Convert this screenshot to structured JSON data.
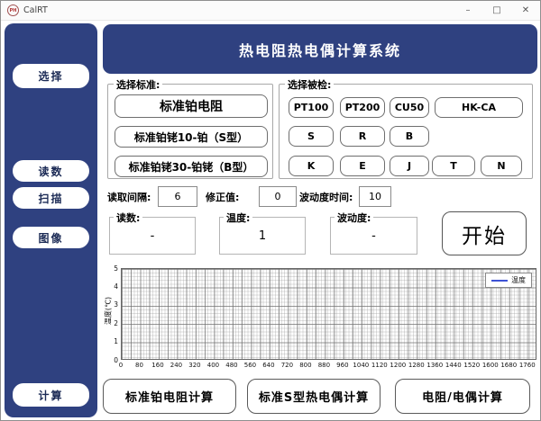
{
  "titlebar": {
    "icon_text": "PH",
    "title": "CalRT",
    "minimize": "–",
    "maximize": "□",
    "close": "✕"
  },
  "sidebar": {
    "items": [
      "选择",
      "读数",
      "扫描",
      "图像",
      "计算"
    ]
  },
  "header": {
    "title": "热电阻热电偶计算系统"
  },
  "standard_group": {
    "label": "选择标准:",
    "buttons": [
      "标准铂电阻",
      "标准铂铑10-铂（S型）",
      "标准铂铑30-铂铑（B型）"
    ]
  },
  "device_group": {
    "label": "选择被检:",
    "rows": [
      [
        "PT100",
        "PT200",
        "CU50",
        "HK-CA"
      ],
      [
        "S",
        "R",
        "B"
      ],
      [
        "K",
        "E",
        "J",
        "T",
        "N"
      ]
    ]
  },
  "params": [
    {
      "label": "读取间隔:",
      "value": "6"
    },
    {
      "label": "修正值:",
      "value": "0"
    },
    {
      "label": "波动度时间:",
      "value": "10"
    }
  ],
  "readouts": [
    {
      "label": "读数:",
      "value": "-"
    },
    {
      "label": "温度:",
      "value": "1"
    },
    {
      "label": "波动度:",
      "value": "-"
    }
  ],
  "start_button": "开始",
  "bottom_buttons": [
    "标准铂电阻计算",
    "标准S型热电偶计算",
    "电阻/电偶计算"
  ],
  "chart_data": {
    "type": "line",
    "title": "",
    "xlabel": "",
    "ylabel": "温度(℃)",
    "xlim": [
      0,
      1800
    ],
    "ylim": [
      0,
      5
    ],
    "x_ticks": [
      0,
      80,
      160,
      240,
      320,
      400,
      480,
      560,
      640,
      720,
      800,
      880,
      960,
      1040,
      1120,
      1200,
      1280,
      1360,
      1440,
      1520,
      1600,
      1680,
      1760
    ],
    "y_ticks": [
      0,
      1,
      2,
      3,
      4,
      5
    ],
    "grid": true,
    "legend_position": "top-right",
    "series": [
      {
        "name": "温度",
        "color": "#3d52d5",
        "x": [],
        "values": []
      }
    ]
  },
  "colors": {
    "navy": "#2f4180",
    "legend_line_blue": "#3d52d5",
    "app_icon_red": "#b03030"
  }
}
